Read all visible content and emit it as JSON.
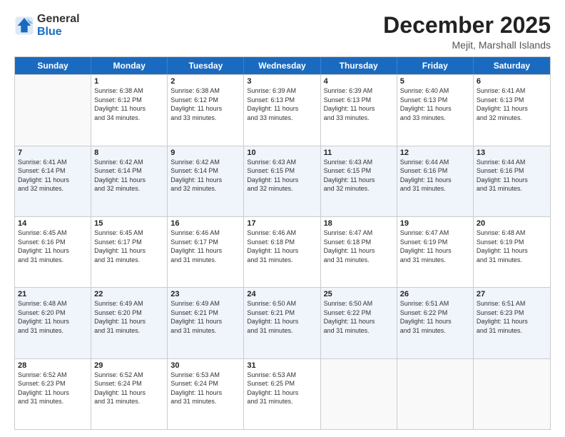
{
  "logo": {
    "general": "General",
    "blue": "Blue"
  },
  "header": {
    "month": "December 2025",
    "location": "Mejit, Marshall Islands"
  },
  "weekdays": [
    "Sunday",
    "Monday",
    "Tuesday",
    "Wednesday",
    "Thursday",
    "Friday",
    "Saturday"
  ],
  "rows": [
    [
      {
        "day": "",
        "info": ""
      },
      {
        "day": "1",
        "info": "Sunrise: 6:38 AM\nSunset: 6:12 PM\nDaylight: 11 hours\nand 34 minutes."
      },
      {
        "day": "2",
        "info": "Sunrise: 6:38 AM\nSunset: 6:12 PM\nDaylight: 11 hours\nand 33 minutes."
      },
      {
        "day": "3",
        "info": "Sunrise: 6:39 AM\nSunset: 6:13 PM\nDaylight: 11 hours\nand 33 minutes."
      },
      {
        "day": "4",
        "info": "Sunrise: 6:39 AM\nSunset: 6:13 PM\nDaylight: 11 hours\nand 33 minutes."
      },
      {
        "day": "5",
        "info": "Sunrise: 6:40 AM\nSunset: 6:13 PM\nDaylight: 11 hours\nand 33 minutes."
      },
      {
        "day": "6",
        "info": "Sunrise: 6:41 AM\nSunset: 6:13 PM\nDaylight: 11 hours\nand 32 minutes."
      }
    ],
    [
      {
        "day": "7",
        "info": "Sunrise: 6:41 AM\nSunset: 6:14 PM\nDaylight: 11 hours\nand 32 minutes."
      },
      {
        "day": "8",
        "info": "Sunrise: 6:42 AM\nSunset: 6:14 PM\nDaylight: 11 hours\nand 32 minutes."
      },
      {
        "day": "9",
        "info": "Sunrise: 6:42 AM\nSunset: 6:14 PM\nDaylight: 11 hours\nand 32 minutes."
      },
      {
        "day": "10",
        "info": "Sunrise: 6:43 AM\nSunset: 6:15 PM\nDaylight: 11 hours\nand 32 minutes."
      },
      {
        "day": "11",
        "info": "Sunrise: 6:43 AM\nSunset: 6:15 PM\nDaylight: 11 hours\nand 32 minutes."
      },
      {
        "day": "12",
        "info": "Sunrise: 6:44 AM\nSunset: 6:16 PM\nDaylight: 11 hours\nand 31 minutes."
      },
      {
        "day": "13",
        "info": "Sunrise: 6:44 AM\nSunset: 6:16 PM\nDaylight: 11 hours\nand 31 minutes."
      }
    ],
    [
      {
        "day": "14",
        "info": "Sunrise: 6:45 AM\nSunset: 6:16 PM\nDaylight: 11 hours\nand 31 minutes."
      },
      {
        "day": "15",
        "info": "Sunrise: 6:45 AM\nSunset: 6:17 PM\nDaylight: 11 hours\nand 31 minutes."
      },
      {
        "day": "16",
        "info": "Sunrise: 6:46 AM\nSunset: 6:17 PM\nDaylight: 11 hours\nand 31 minutes."
      },
      {
        "day": "17",
        "info": "Sunrise: 6:46 AM\nSunset: 6:18 PM\nDaylight: 11 hours\nand 31 minutes."
      },
      {
        "day": "18",
        "info": "Sunrise: 6:47 AM\nSunset: 6:18 PM\nDaylight: 11 hours\nand 31 minutes."
      },
      {
        "day": "19",
        "info": "Sunrise: 6:47 AM\nSunset: 6:19 PM\nDaylight: 11 hours\nand 31 minutes."
      },
      {
        "day": "20",
        "info": "Sunrise: 6:48 AM\nSunset: 6:19 PM\nDaylight: 11 hours\nand 31 minutes."
      }
    ],
    [
      {
        "day": "21",
        "info": "Sunrise: 6:48 AM\nSunset: 6:20 PM\nDaylight: 11 hours\nand 31 minutes."
      },
      {
        "day": "22",
        "info": "Sunrise: 6:49 AM\nSunset: 6:20 PM\nDaylight: 11 hours\nand 31 minutes."
      },
      {
        "day": "23",
        "info": "Sunrise: 6:49 AM\nSunset: 6:21 PM\nDaylight: 11 hours\nand 31 minutes."
      },
      {
        "day": "24",
        "info": "Sunrise: 6:50 AM\nSunset: 6:21 PM\nDaylight: 11 hours\nand 31 minutes."
      },
      {
        "day": "25",
        "info": "Sunrise: 6:50 AM\nSunset: 6:22 PM\nDaylight: 11 hours\nand 31 minutes."
      },
      {
        "day": "26",
        "info": "Sunrise: 6:51 AM\nSunset: 6:22 PM\nDaylight: 11 hours\nand 31 minutes."
      },
      {
        "day": "27",
        "info": "Sunrise: 6:51 AM\nSunset: 6:23 PM\nDaylight: 11 hours\nand 31 minutes."
      }
    ],
    [
      {
        "day": "28",
        "info": "Sunrise: 6:52 AM\nSunset: 6:23 PM\nDaylight: 11 hours\nand 31 minutes."
      },
      {
        "day": "29",
        "info": "Sunrise: 6:52 AM\nSunset: 6:24 PM\nDaylight: 11 hours\nand 31 minutes."
      },
      {
        "day": "30",
        "info": "Sunrise: 6:53 AM\nSunset: 6:24 PM\nDaylight: 11 hours\nand 31 minutes."
      },
      {
        "day": "31",
        "info": "Sunrise: 6:53 AM\nSunset: 6:25 PM\nDaylight: 11 hours\nand 31 minutes."
      },
      {
        "day": "",
        "info": ""
      },
      {
        "day": "",
        "info": ""
      },
      {
        "day": "",
        "info": ""
      }
    ]
  ]
}
